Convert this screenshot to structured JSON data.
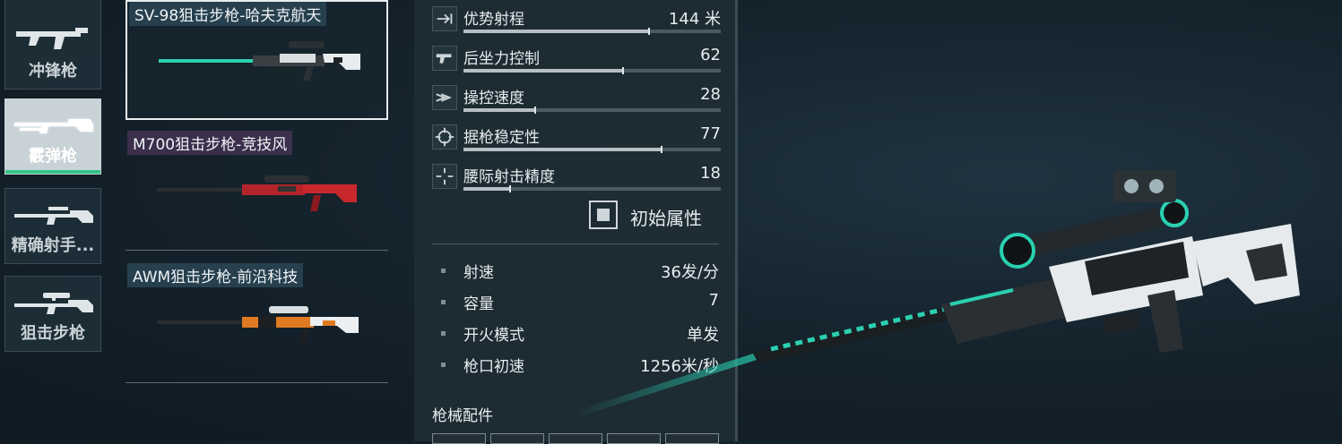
{
  "categories": [
    {
      "label": "冲锋枪",
      "icon": "smg-icon"
    },
    {
      "label": "霰弹枪",
      "icon": "shotgun-icon",
      "active": true
    },
    {
      "label": "精确射手...",
      "icon": "marksman-rifle-icon"
    },
    {
      "label": "狙击步枪",
      "icon": "sniper-rifle-icon"
    }
  ],
  "skins": [
    {
      "name": "SV-98狙击步枪-哈夫克航天",
      "name_bg": "#27404e",
      "accent": "#2ad0b0",
      "selected": true
    },
    {
      "name": "M700狙击步枪-竞技风",
      "name_bg": "#3c2f4c",
      "accent": "#c8282c"
    },
    {
      "name": "AWM狙击步枪-前沿科技",
      "name_bg": "#27404e",
      "accent": "#e07a22"
    }
  ],
  "stats": [
    {
      "label": "优势射程",
      "value": "144 米",
      "icon": "range-arrow-icon",
      "level": 0.72
    },
    {
      "label": "后坐力控制",
      "value": "62",
      "icon": "recoil-gun-icon",
      "level": 0.62
    },
    {
      "label": "操控速度",
      "value": "28",
      "icon": "handling-speed-icon",
      "level": 0.28
    },
    {
      "label": "据枪稳定性",
      "value": "77",
      "icon": "crosshair-icon",
      "level": 0.77
    },
    {
      "label": "腰际射击精度",
      "value": "18",
      "icon": "hipfire-reticle-icon",
      "level": 0.18
    }
  ],
  "toggle": {
    "label": "初始属性",
    "checked": true
  },
  "attributes": [
    {
      "label": "射速",
      "value": "36发/分"
    },
    {
      "label": "容量",
      "value": "7"
    },
    {
      "label": "开火模式",
      "value": "单发"
    },
    {
      "label": "枪口初速",
      "value": "1256米/秒"
    }
  ],
  "attachments_title": "枪械配件",
  "colors": {
    "accent_green": "#35c48a",
    "teal": "#2ad0b0"
  }
}
